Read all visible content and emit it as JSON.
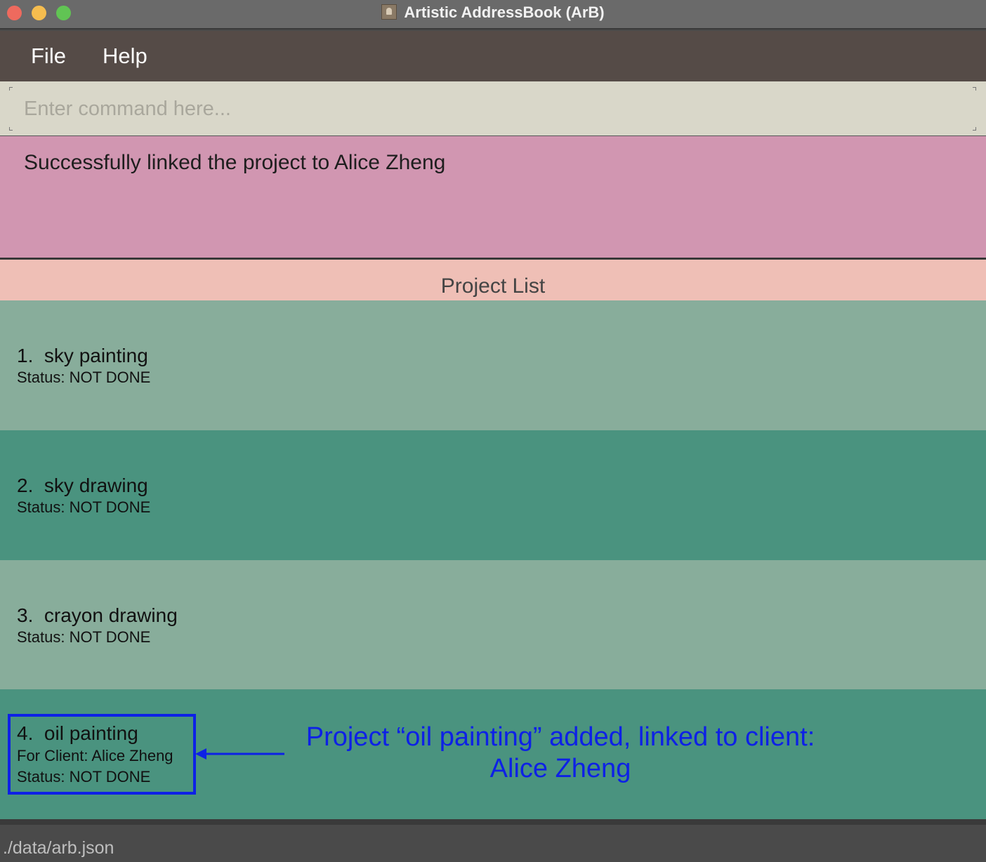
{
  "window": {
    "title": "Artistic AddressBook (ArB)"
  },
  "menu": {
    "file": "File",
    "help": "Help"
  },
  "command": {
    "placeholder": "Enter command here...",
    "value": ""
  },
  "result": {
    "message": "Successfully linked the project to Alice Zheng"
  },
  "project_list": {
    "header": "Project List",
    "items": [
      {
        "title": "1.  sky painting",
        "status": "Status: NOT DONE"
      },
      {
        "title": "2.  sky drawing",
        "status": "Status: NOT DONE"
      },
      {
        "title": "3.  crayon drawing",
        "status": "Status: NOT DONE"
      },
      {
        "title": "4.  oil painting",
        "client": "For Client: Alice Zheng",
        "status": "Status: NOT DONE"
      }
    ]
  },
  "annotation": {
    "line1": "Project “oil painting” added, linked to client:",
    "line2": "Alice Zheng"
  },
  "status_bar": {
    "path": "./data/arb.json"
  },
  "colors": {
    "result_bg": "#d196b1",
    "header_bg": "#efbfb6",
    "card_light": "#88ad9b",
    "card_dark": "#4a937f",
    "annotation": "#0d21e6"
  }
}
